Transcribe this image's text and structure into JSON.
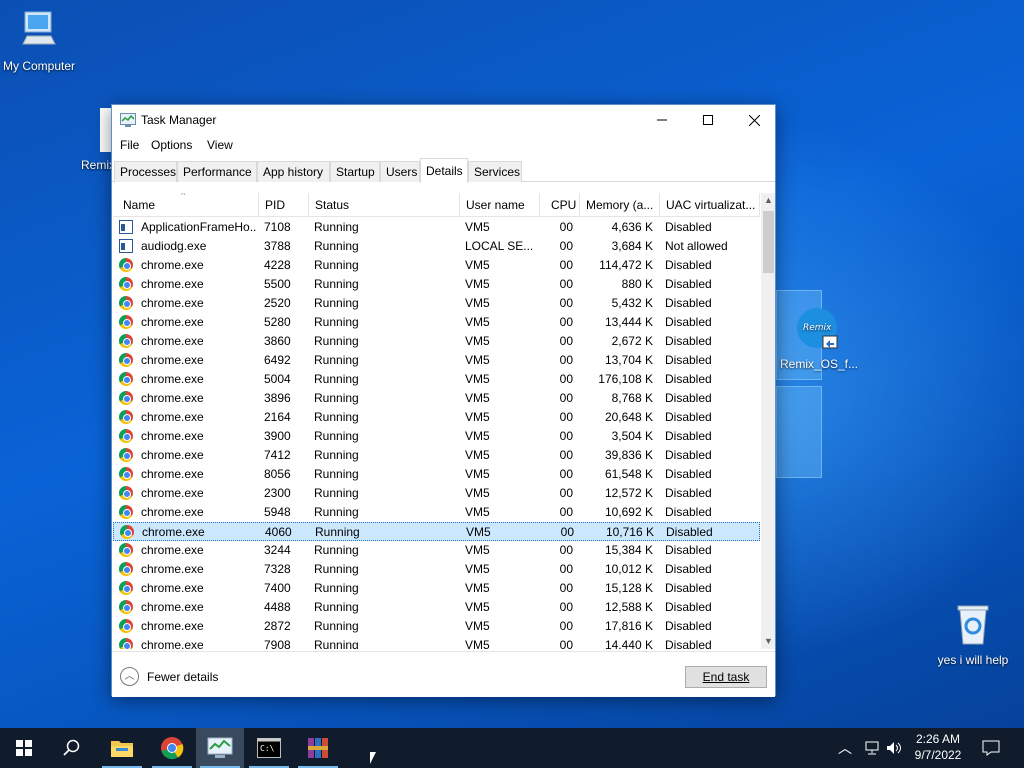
{
  "desktop": {
    "icons": [
      {
        "id": "my-computer",
        "label": "My Computer"
      },
      {
        "id": "remix-os",
        "label": "Remix_OS_f..."
      },
      {
        "id": "recycle-bin",
        "label": "yes i will help"
      }
    ],
    "partial_label": "Remix"
  },
  "window": {
    "title": "Task Manager",
    "menu": [
      "File",
      "Options",
      "View"
    ],
    "tabs": [
      "Processes",
      "Performance",
      "App history",
      "Startup",
      "Users",
      "Details",
      "Services"
    ],
    "active_tab": "Details",
    "columns": [
      "Name",
      "PID",
      "Status",
      "User name",
      "CPU",
      "Memory (a...",
      "UAC virtualizat..."
    ],
    "rows": [
      {
        "icon": "app",
        "name": "ApplicationFrameHo...",
        "pid": "7108",
        "status": "Running",
        "user": "VM5",
        "cpu": "00",
        "mem": "4,636 K",
        "uac": "Disabled"
      },
      {
        "icon": "app",
        "name": "audiodg.exe",
        "pid": "3788",
        "status": "Running",
        "user": "LOCAL SE...",
        "cpu": "00",
        "mem": "3,684 K",
        "uac": "Not allowed"
      },
      {
        "icon": "chrome",
        "name": "chrome.exe",
        "pid": "4228",
        "status": "Running",
        "user": "VM5",
        "cpu": "00",
        "mem": "114,472 K",
        "uac": "Disabled"
      },
      {
        "icon": "chrome",
        "name": "chrome.exe",
        "pid": "5500",
        "status": "Running",
        "user": "VM5",
        "cpu": "00",
        "mem": "880 K",
        "uac": "Disabled"
      },
      {
        "icon": "chrome",
        "name": "chrome.exe",
        "pid": "2520",
        "status": "Running",
        "user": "VM5",
        "cpu": "00",
        "mem": "5,432 K",
        "uac": "Disabled"
      },
      {
        "icon": "chrome",
        "name": "chrome.exe",
        "pid": "5280",
        "status": "Running",
        "user": "VM5",
        "cpu": "00",
        "mem": "13,444 K",
        "uac": "Disabled"
      },
      {
        "icon": "chrome",
        "name": "chrome.exe",
        "pid": "3860",
        "status": "Running",
        "user": "VM5",
        "cpu": "00",
        "mem": "2,672 K",
        "uac": "Disabled"
      },
      {
        "icon": "chrome",
        "name": "chrome.exe",
        "pid": "6492",
        "status": "Running",
        "user": "VM5",
        "cpu": "00",
        "mem": "13,704 K",
        "uac": "Disabled"
      },
      {
        "icon": "chrome",
        "name": "chrome.exe",
        "pid": "5004",
        "status": "Running",
        "user": "VM5",
        "cpu": "00",
        "mem": "176,108 K",
        "uac": "Disabled"
      },
      {
        "icon": "chrome",
        "name": "chrome.exe",
        "pid": "3896",
        "status": "Running",
        "user": "VM5",
        "cpu": "00",
        "mem": "8,768 K",
        "uac": "Disabled"
      },
      {
        "icon": "chrome",
        "name": "chrome.exe",
        "pid": "2164",
        "status": "Running",
        "user": "VM5",
        "cpu": "00",
        "mem": "20,648 K",
        "uac": "Disabled"
      },
      {
        "icon": "chrome",
        "name": "chrome.exe",
        "pid": "3900",
        "status": "Running",
        "user": "VM5",
        "cpu": "00",
        "mem": "3,504 K",
        "uac": "Disabled"
      },
      {
        "icon": "chrome",
        "name": "chrome.exe",
        "pid": "7412",
        "status": "Running",
        "user": "VM5",
        "cpu": "00",
        "mem": "39,836 K",
        "uac": "Disabled"
      },
      {
        "icon": "chrome",
        "name": "chrome.exe",
        "pid": "8056",
        "status": "Running",
        "user": "VM5",
        "cpu": "00",
        "mem": "61,548 K",
        "uac": "Disabled"
      },
      {
        "icon": "chrome",
        "name": "chrome.exe",
        "pid": "2300",
        "status": "Running",
        "user": "VM5",
        "cpu": "00",
        "mem": "12,572 K",
        "uac": "Disabled"
      },
      {
        "icon": "chrome",
        "name": "chrome.exe",
        "pid": "5948",
        "status": "Running",
        "user": "VM5",
        "cpu": "00",
        "mem": "10,692 K",
        "uac": "Disabled"
      },
      {
        "icon": "chrome",
        "name": "chrome.exe",
        "pid": "4060",
        "status": "Running",
        "user": "VM5",
        "cpu": "00",
        "mem": "10,716 K",
        "uac": "Disabled",
        "selected": true
      },
      {
        "icon": "chrome",
        "name": "chrome.exe",
        "pid": "3244",
        "status": "Running",
        "user": "VM5",
        "cpu": "00",
        "mem": "15,384 K",
        "uac": "Disabled"
      },
      {
        "icon": "chrome",
        "name": "chrome.exe",
        "pid": "7328",
        "status": "Running",
        "user": "VM5",
        "cpu": "00",
        "mem": "10,012 K",
        "uac": "Disabled"
      },
      {
        "icon": "chrome",
        "name": "chrome.exe",
        "pid": "7400",
        "status": "Running",
        "user": "VM5",
        "cpu": "00",
        "mem": "15,128 K",
        "uac": "Disabled"
      },
      {
        "icon": "chrome",
        "name": "chrome.exe",
        "pid": "4488",
        "status": "Running",
        "user": "VM5",
        "cpu": "00",
        "mem": "12,588 K",
        "uac": "Disabled"
      },
      {
        "icon": "chrome",
        "name": "chrome.exe",
        "pid": "2872",
        "status": "Running",
        "user": "VM5",
        "cpu": "00",
        "mem": "17,816 K",
        "uac": "Disabled"
      },
      {
        "icon": "chrome",
        "name": "chrome.exe",
        "pid": "7908",
        "status": "Running",
        "user": "VM5",
        "cpu": "00",
        "mem": "14,440 K",
        "uac": "Disabled"
      }
    ],
    "fewer_details": "Fewer details",
    "end_task": "End task"
  },
  "taskbar": {
    "time": "2:26 AM",
    "date": "9/7/2022",
    "apps": [
      "start-icon",
      "search-icon",
      "file-explorer-icon",
      "chrome-icon",
      "task-manager-icon",
      "command-prompt-icon",
      "winrar-icon"
    ]
  },
  "colors": {
    "accent": "#0078d7",
    "selection": "#cce8ff",
    "taskbar": "#101c2c"
  }
}
